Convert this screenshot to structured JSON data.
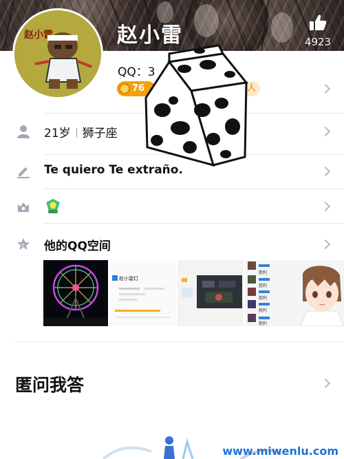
{
  "profile": {
    "name": "赵小雷",
    "likes": "4923",
    "qq_prefix": "QQ：3",
    "level": "76",
    "vip_fragment": "人"
  },
  "rows": {
    "age": "21岁",
    "zodiac": "狮子座",
    "signature": "Te quiero  Te extraño.",
    "qzone_title": "他的QQ空间"
  },
  "qa": {
    "title": "匿问我答"
  },
  "thumbs": {
    "t2_name": "赵小雷灯",
    "t4_labels": [
      "胜利",
      "胜利",
      "胜利",
      "胜利",
      "胜利"
    ]
  },
  "avatar_text": "赵小雷",
  "watermark": "www.miwenlu.com",
  "icons": [
    "thumb-up-icon",
    "person-icon",
    "pencil-icon",
    "crown-icon",
    "qzone-star-icon",
    "chevron-right-icon"
  ],
  "colors": {
    "accent_orange": "#f4a10c",
    "watermark_blue": "#1a73d9",
    "divider": "#e6e6e6"
  }
}
